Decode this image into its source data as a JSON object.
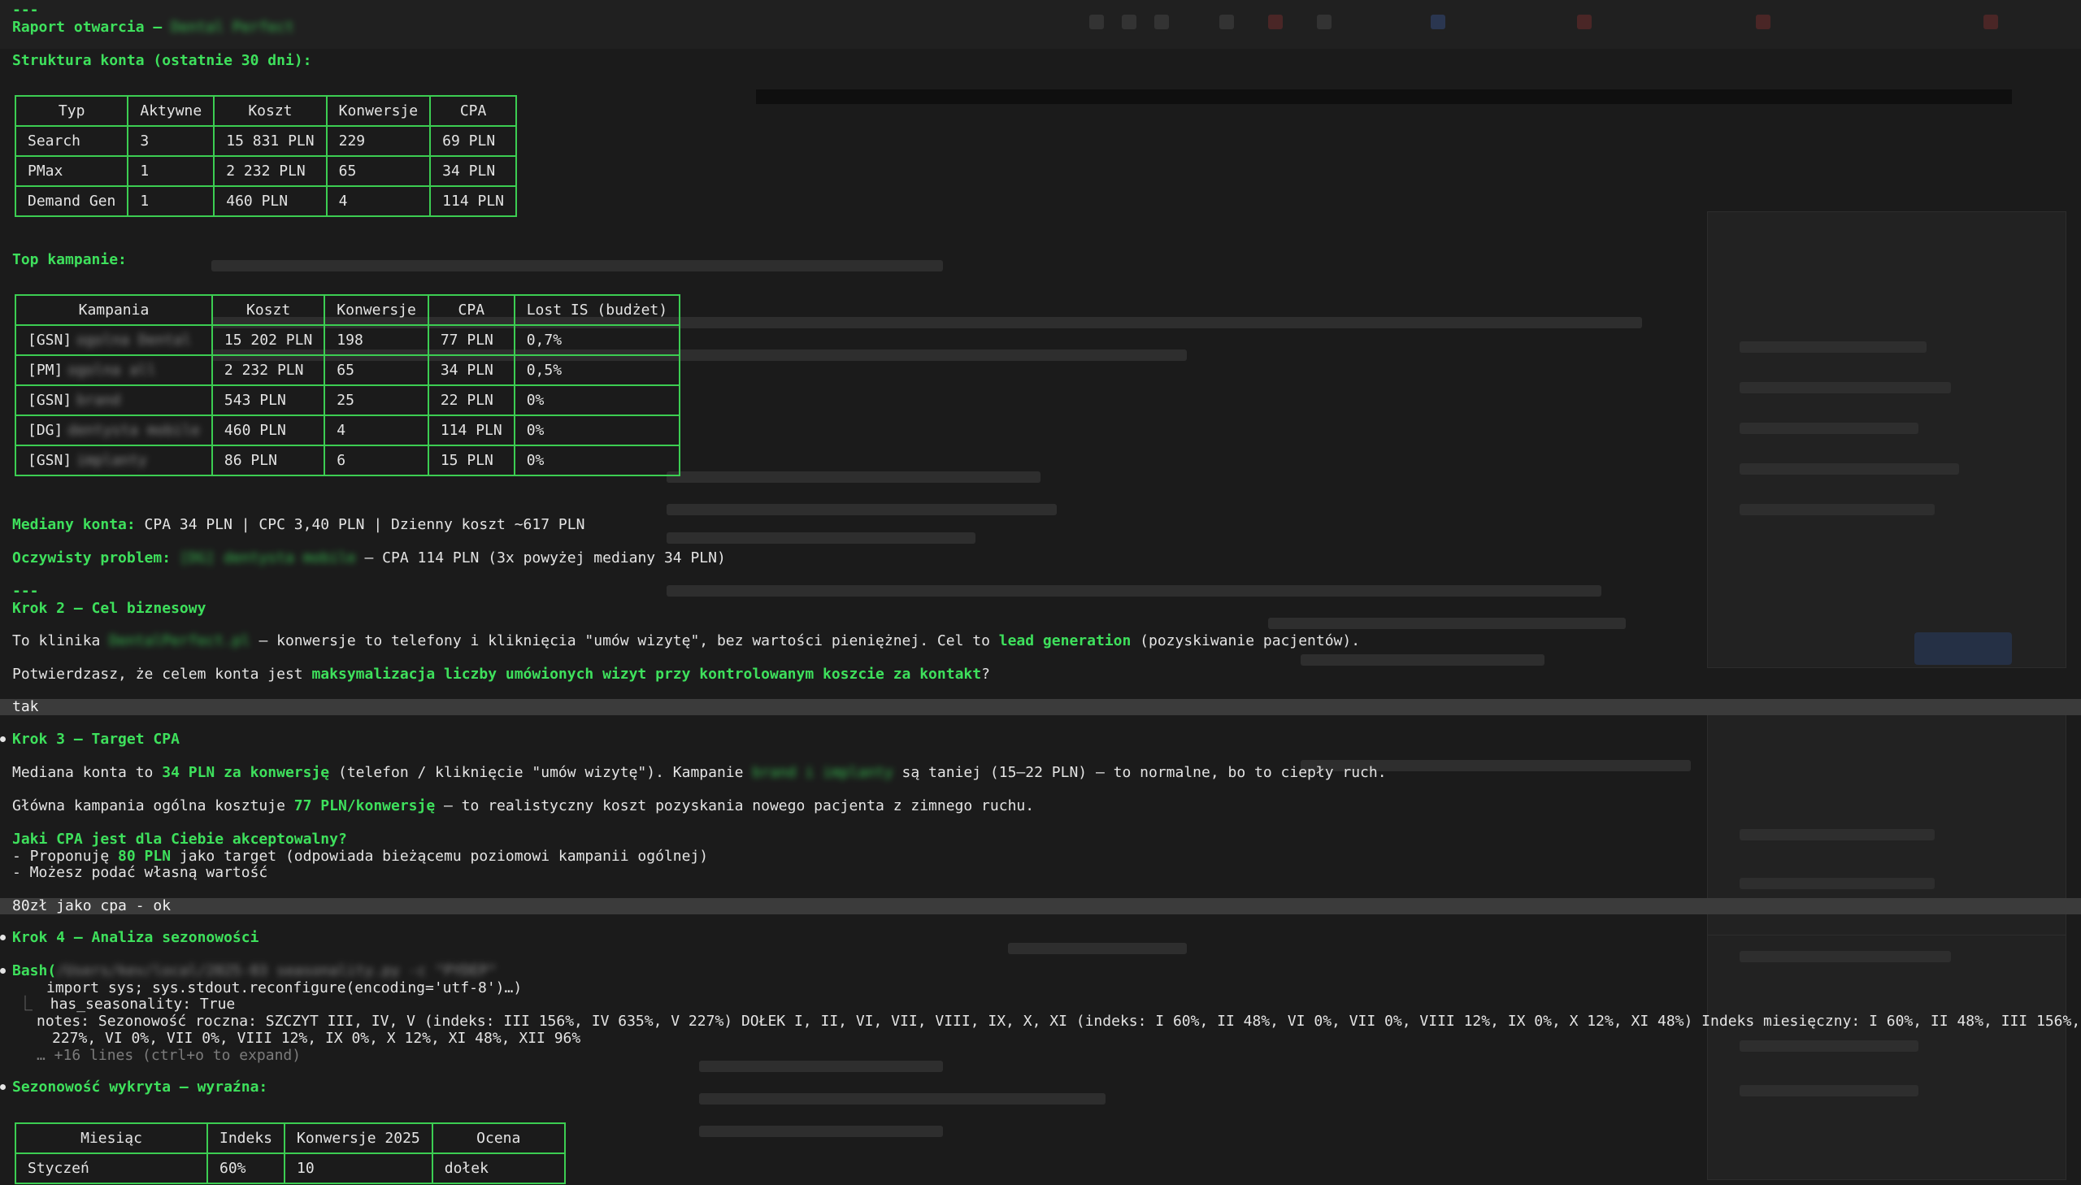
{
  "report": {
    "sep1": "---",
    "title_prefix": "Raport otwarcia — ",
    "title_redacted": "Dental Perfect",
    "structure_heading": "Struktura konta (ostatnie 30 dni):"
  },
  "structure_table": {
    "headers": [
      "Typ",
      "Aktywne",
      "Koszt",
      "Konwersje",
      "CPA"
    ],
    "rows": [
      [
        "Search",
        "3",
        "15 831 PLN",
        "229",
        "69 PLN"
      ],
      [
        "PMax",
        "1",
        "2 232 PLN",
        "65",
        "34 PLN"
      ],
      [
        "Demand Gen",
        "1",
        "460 PLN",
        "4",
        "114 PLN"
      ]
    ]
  },
  "top_heading": "Top kampanie:",
  "campaigns_table": {
    "headers": [
      "Kampania",
      "Koszt",
      "Konwersje",
      "CPA",
      "Lost IS (budżet)"
    ],
    "rows": [
      {
        "prefix": "[GSN]",
        "name": "ogolna Dental",
        "cost": "15 202 PLN",
        "conv": "198",
        "cpa": "77 PLN",
        "lost": "0,7%"
      },
      {
        "prefix": "[PM]",
        "name": "ogolna all",
        "cost": "2 232 PLN",
        "conv": "65",
        "cpa": "34 PLN",
        "lost": "0,5%"
      },
      {
        "prefix": "[GSN]",
        "name": "brand",
        "cost": "543 PLN",
        "conv": "25",
        "cpa": "22 PLN",
        "lost": "0%"
      },
      {
        "prefix": "[DG]",
        "name": "dentysta mobile",
        "cost": "460 PLN",
        "conv": "4",
        "cpa": "114 PLN",
        "lost": "0%"
      },
      {
        "prefix": "[GSN]",
        "name": "implanty",
        "cost": "86 PLN",
        "conv": "6",
        "cpa": "15 PLN",
        "lost": "0%"
      }
    ]
  },
  "medians": {
    "label": "Mediany konta:",
    "text": " CPA 34 PLN | CPC 3,40 PLN | Dzienny koszt ~617 PLN"
  },
  "problem": {
    "label": "Oczywisty problem:",
    "redacted": "[DG] dentysta mobile",
    "text": " — CPA 114 PLN (3x powyżej mediany 34 PLN)"
  },
  "sep2": "---",
  "step2": {
    "heading": "Krok 2 — Cel biznesowy",
    "p1_a": "To klinika ",
    "p1_redacted": "DentalPerfect.pl",
    "p1_b": " — konwersje to telefony i kliknięcia \"umów wizytę\", bez wartości pieniężnej. Cel to ",
    "p1_bold": "lead generation",
    "p1_c": " (pozyskiwanie pacjentów).",
    "p2_a": "Potwierdzasz, że celem konta jest ",
    "p2_bold": "maksymalizacja liczby umówionych wizyt przy kontrolowanym koszcie za kontakt",
    "p2_c": "?"
  },
  "user_input_1": "tak",
  "step3": {
    "heading": "Krok 3 — Target CPA",
    "p1_a": "Mediana konta to ",
    "p1_bold": "34 PLN za konwersję",
    "p1_b": " (telefon / kliknięcie \"umów wizytę\"). Kampanie ",
    "p1_redacted": "brand i implanty",
    "p1_c": " są taniej (15–22 PLN) — to normalne, bo to ciepły ruch.",
    "p2_a": "Główna kampania ogólna kosztuje ",
    "p2_bold": "77 PLN/konwersję",
    "p2_c": " — to realistyczny koszt pozyskania nowego pacjenta z zimnego ruchu.",
    "question": "Jaki CPA jest dla Ciebie akceptowalny?",
    "opt1_a": "- Proponuję ",
    "opt1_bold": "80 PLN",
    "opt1_b": " jako target (odpowiada bieżącemu poziomowi kampanii ogólnej)",
    "opt2": "- Możesz podać własną wartość"
  },
  "user_input_2": "80zł jako cpa - ok",
  "step4": {
    "heading": "Krok 4 — Analiza sezonowości",
    "bash_label": "Bash(",
    "bash_redacted": "/Users/kev/local/2025-03 seasonality.py -c \"PYDEP\"",
    "bash_line2": "import sys; sys.stdout.reconfigure(encoding='utf-8')…)",
    "out1": "has_seasonality: True",
    "out2": "notes: Sezonowość roczna: SZCZYT III, IV, V (indeks: III 156%, IV 635%, V 227%) DOŁEK I, II, VI, VII, VIII, IX, X, XI (indeks: I 60%, II 48%, VI 0%, VII 0%, VIII 12%, IX 0%, X 12%, XI 48%) Indeks miesięczny: I 60%, II 48%, III 156%, IV 635%, V",
    "out3": "227%, VI 0%, VII 0%, VIII 12%, IX 0%, X 12%, XI 48%, XII 96%",
    "expand": "… +16 lines (ctrl+o to expand)",
    "season_heading": "Sezonowość wykryta — wyraźna:"
  },
  "season_table": {
    "headers": [
      "Miesiąc",
      "Indeks",
      "Konwersje 2025",
      "Ocena"
    ],
    "rows": [
      [
        "Styczeń",
        "60%",
        "10",
        "dołek"
      ]
    ]
  },
  "colors": {
    "accent": "#3ee05c",
    "border": "#3ccd52",
    "bg": "#1b1b1b",
    "input_bar": "#3b3b3b"
  }
}
